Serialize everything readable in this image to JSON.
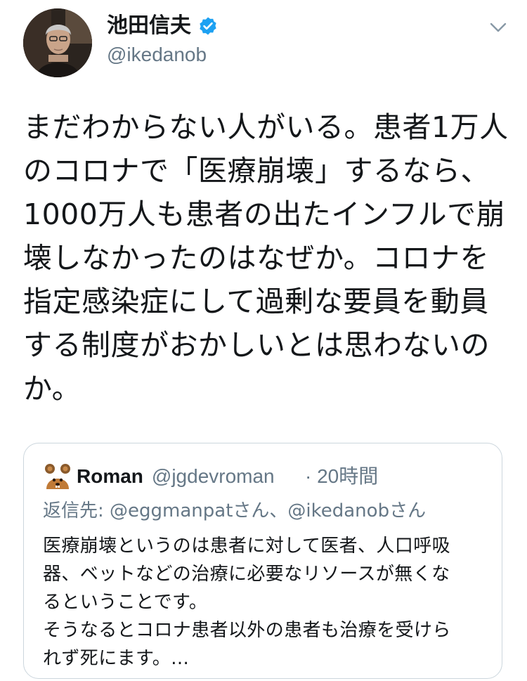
{
  "author": {
    "display_name": "池田信夫",
    "handle": "@ikedanob",
    "verified": true
  },
  "tweet": {
    "lines": [
      "まだわからない人がいる。患者1万人",
      "のコロナで「医療崩壊」するなら、",
      "1000万人も患者の出たインフルで崩",
      "壊しなかったのはなぜか。コロナを",
      "指定感染症にして過剰な要員を動員",
      "する制度がおかしいとは思わないの",
      "か。"
    ]
  },
  "quote": {
    "name": "Roman",
    "handle": "@jgdevroman",
    "separator": "·",
    "time": "20時間",
    "reply_to": "返信先: @eggmanpatさん、@ikedanobさん",
    "body_lines": [
      "医療崩壊というのは患者に対して医者、人口呼吸",
      "器、ベットなどの治療に必要なリソースが無くな",
      "るということです。",
      "そうなるとコロナ患者以外の患者も治療を受けら",
      "れず死にます。..."
    ]
  },
  "icons": {
    "verified": "verified-badge-icon",
    "menu": "chevron-down-icon",
    "quote_avatar": "mouse-emoji-avatar"
  },
  "colors": {
    "text": "#14171a",
    "secondary": "#657786",
    "verified": "#1da1f2",
    "border": "#ccd6dd"
  }
}
